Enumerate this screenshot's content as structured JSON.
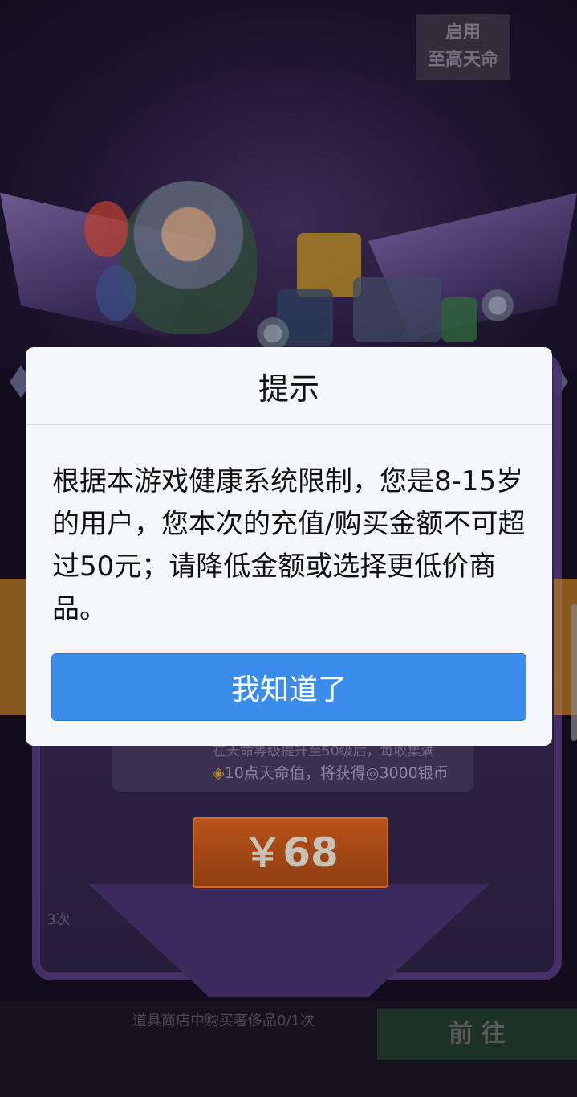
{
  "background": {
    "top_badge": [
      "启用",
      "至高天命"
    ],
    "info_line1": "在天命等级提升至50级后，每收集满",
    "info_line2_prefix": "10点天命值，将获得",
    "info_line2_suffix": "3000银币",
    "price": "￥68",
    "times_tag": "3次",
    "task_text": "道具商店中购买奢侈品0/1次",
    "go_button": "前 往"
  },
  "dialog": {
    "title": "提示",
    "message": "根据本游戏健康系统限制，您是8-15岁的用户，您本次的充值/购买金额不可超过50元；请降低金额或选择更低价商品。",
    "confirm_label": "我知道了"
  },
  "colors": {
    "dialog_bg": "#f5f6fa",
    "primary_button": "#3b8dec",
    "overlay": "#120d1c"
  }
}
